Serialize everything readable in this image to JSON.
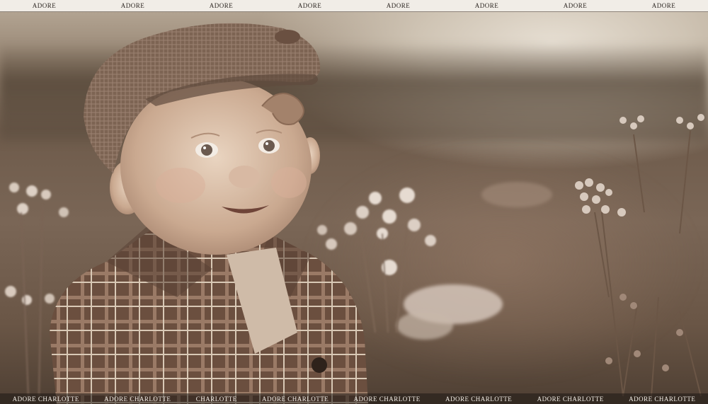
{
  "watermark_top": [
    "ADORE",
    "ADORE",
    "ADORE",
    "ADORE",
    "ADORE",
    "ADORE",
    "ADORE",
    "ADORE"
  ],
  "watermark_bottom": [
    "ADORE CHARLOTTE",
    "ADORE CHARLOTTE",
    "CHARLOTTE",
    "ADORE CHARLOTTE",
    "ADORE CHARLOTTE",
    "ADORE CHARLOTTE",
    "ADORE CHARLOTTE",
    "ADORE CHARLOTTE"
  ],
  "tone": {
    "sepia_light": "#e6ded2",
    "sepia_mid": "#8f7d6b",
    "sepia_dark": "#4e3f33"
  }
}
